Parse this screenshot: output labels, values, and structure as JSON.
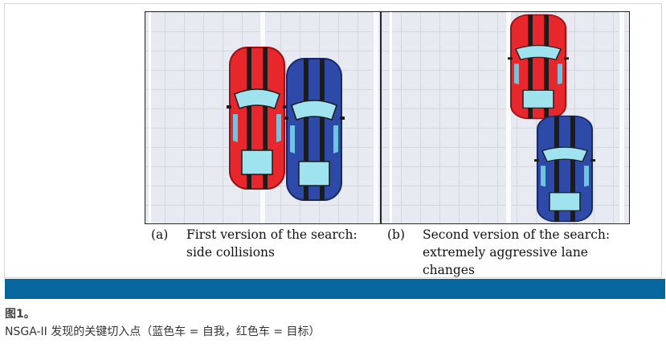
{
  "figure": {
    "panel_a": {
      "letter": "(a)",
      "caption_line1": "First version of the search:",
      "caption_line2": "side collisions",
      "cars": [
        {
          "role": "target",
          "color": "#e8272c",
          "icon": "red-car-icon"
        },
        {
          "role": "ego",
          "color": "#2e4aa8",
          "icon": "blue-car-icon"
        }
      ]
    },
    "panel_b": {
      "letter": "(b)",
      "caption_line1": "Second version of the search:",
      "caption_line2": "extremely aggressive lane",
      "caption_line3": "changes",
      "cars": [
        {
          "role": "target",
          "color": "#e8272c",
          "icon": "red-car-icon"
        },
        {
          "role": "ego",
          "color": "#2e4aa8",
          "icon": "blue-car-icon"
        }
      ]
    }
  },
  "caption_bar": {
    "color": "#07669e"
  },
  "figure_label": "图1。",
  "figure_caption": "NSGA-II 发现的关键切入点（蓝色车 = 自我，红色车 = 目标）"
}
